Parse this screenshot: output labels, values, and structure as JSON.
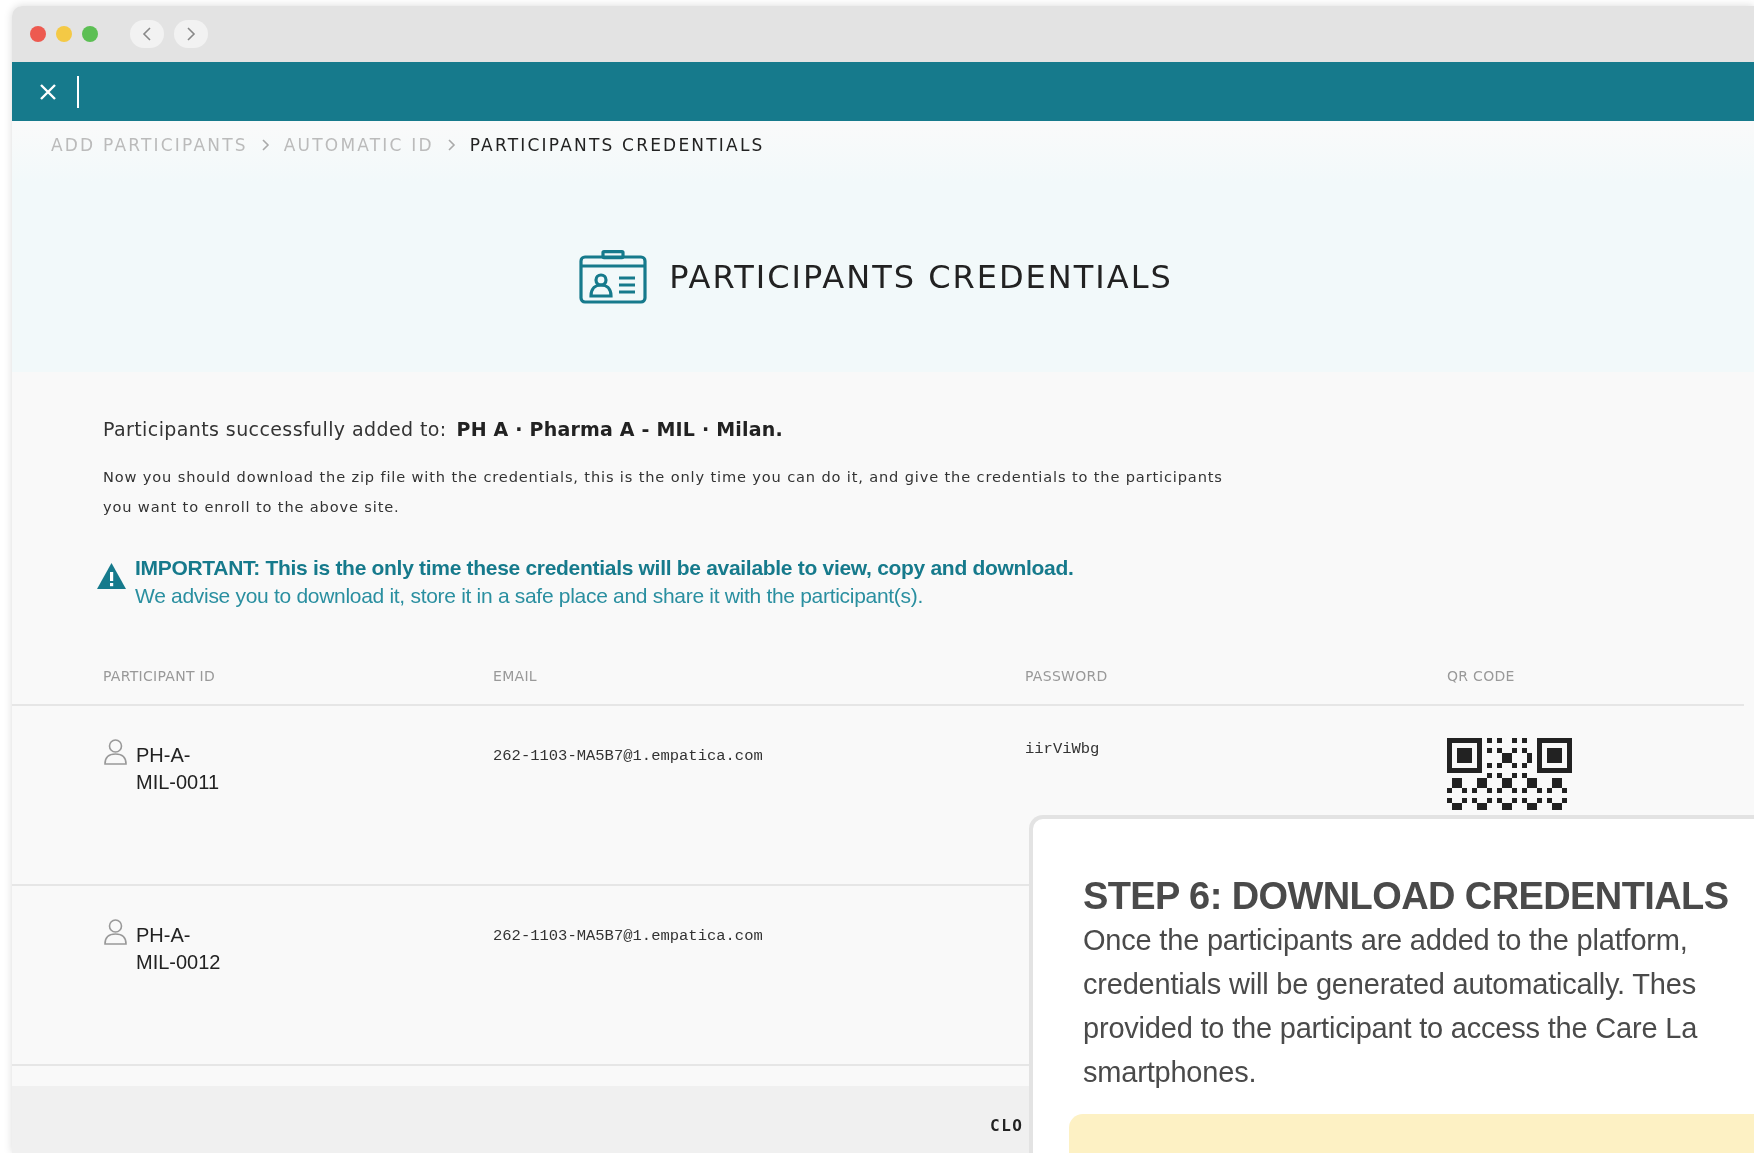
{
  "breadcrumbs": [
    {
      "label": "ADD PARTICIPANTS",
      "current": false
    },
    {
      "label": "AUTOMATIC ID",
      "current": false
    },
    {
      "label": "PARTICIPANTS CREDENTIALS",
      "current": true
    }
  ],
  "page_title": "PARTICIPANTS CREDENTIALS",
  "success": {
    "label": "Participants successfully added to:",
    "site": "PH A · Pharma A - MIL · Milan."
  },
  "instructions": "Now you should download the zip file with the credentials, this is the only time you can do it, and give the credentials to the participants you want to enroll to the above site.",
  "important": {
    "heading": "IMPORTANT: This is the only time these credentials will be available to view, copy and download.",
    "text": "We advise you to download it, store it in a safe place and share it with the participant(s)."
  },
  "table": {
    "columns": [
      "PARTICIPANT ID",
      "EMAIL",
      "PASSWORD",
      "QR CODE"
    ],
    "rows": [
      {
        "participant_id": "PH-A-MIL-0011",
        "email": "262-1103-MA5B7@1.empatica.com",
        "password": "iirViWbg"
      },
      {
        "participant_id": "PH-A-MIL-0012",
        "email": "262-1103-MA5B7@1.empatica.com"
      }
    ]
  },
  "footer": {
    "button": "CLO"
  },
  "tip": {
    "title": "STEP 6: DOWNLOAD CREDENTIALS",
    "lines": [
      "Once the participants are added to the platform,",
      "credentials will be generated automatically. Thes",
      "provided to the participant to access the Care La",
      "smartphones."
    ]
  }
}
